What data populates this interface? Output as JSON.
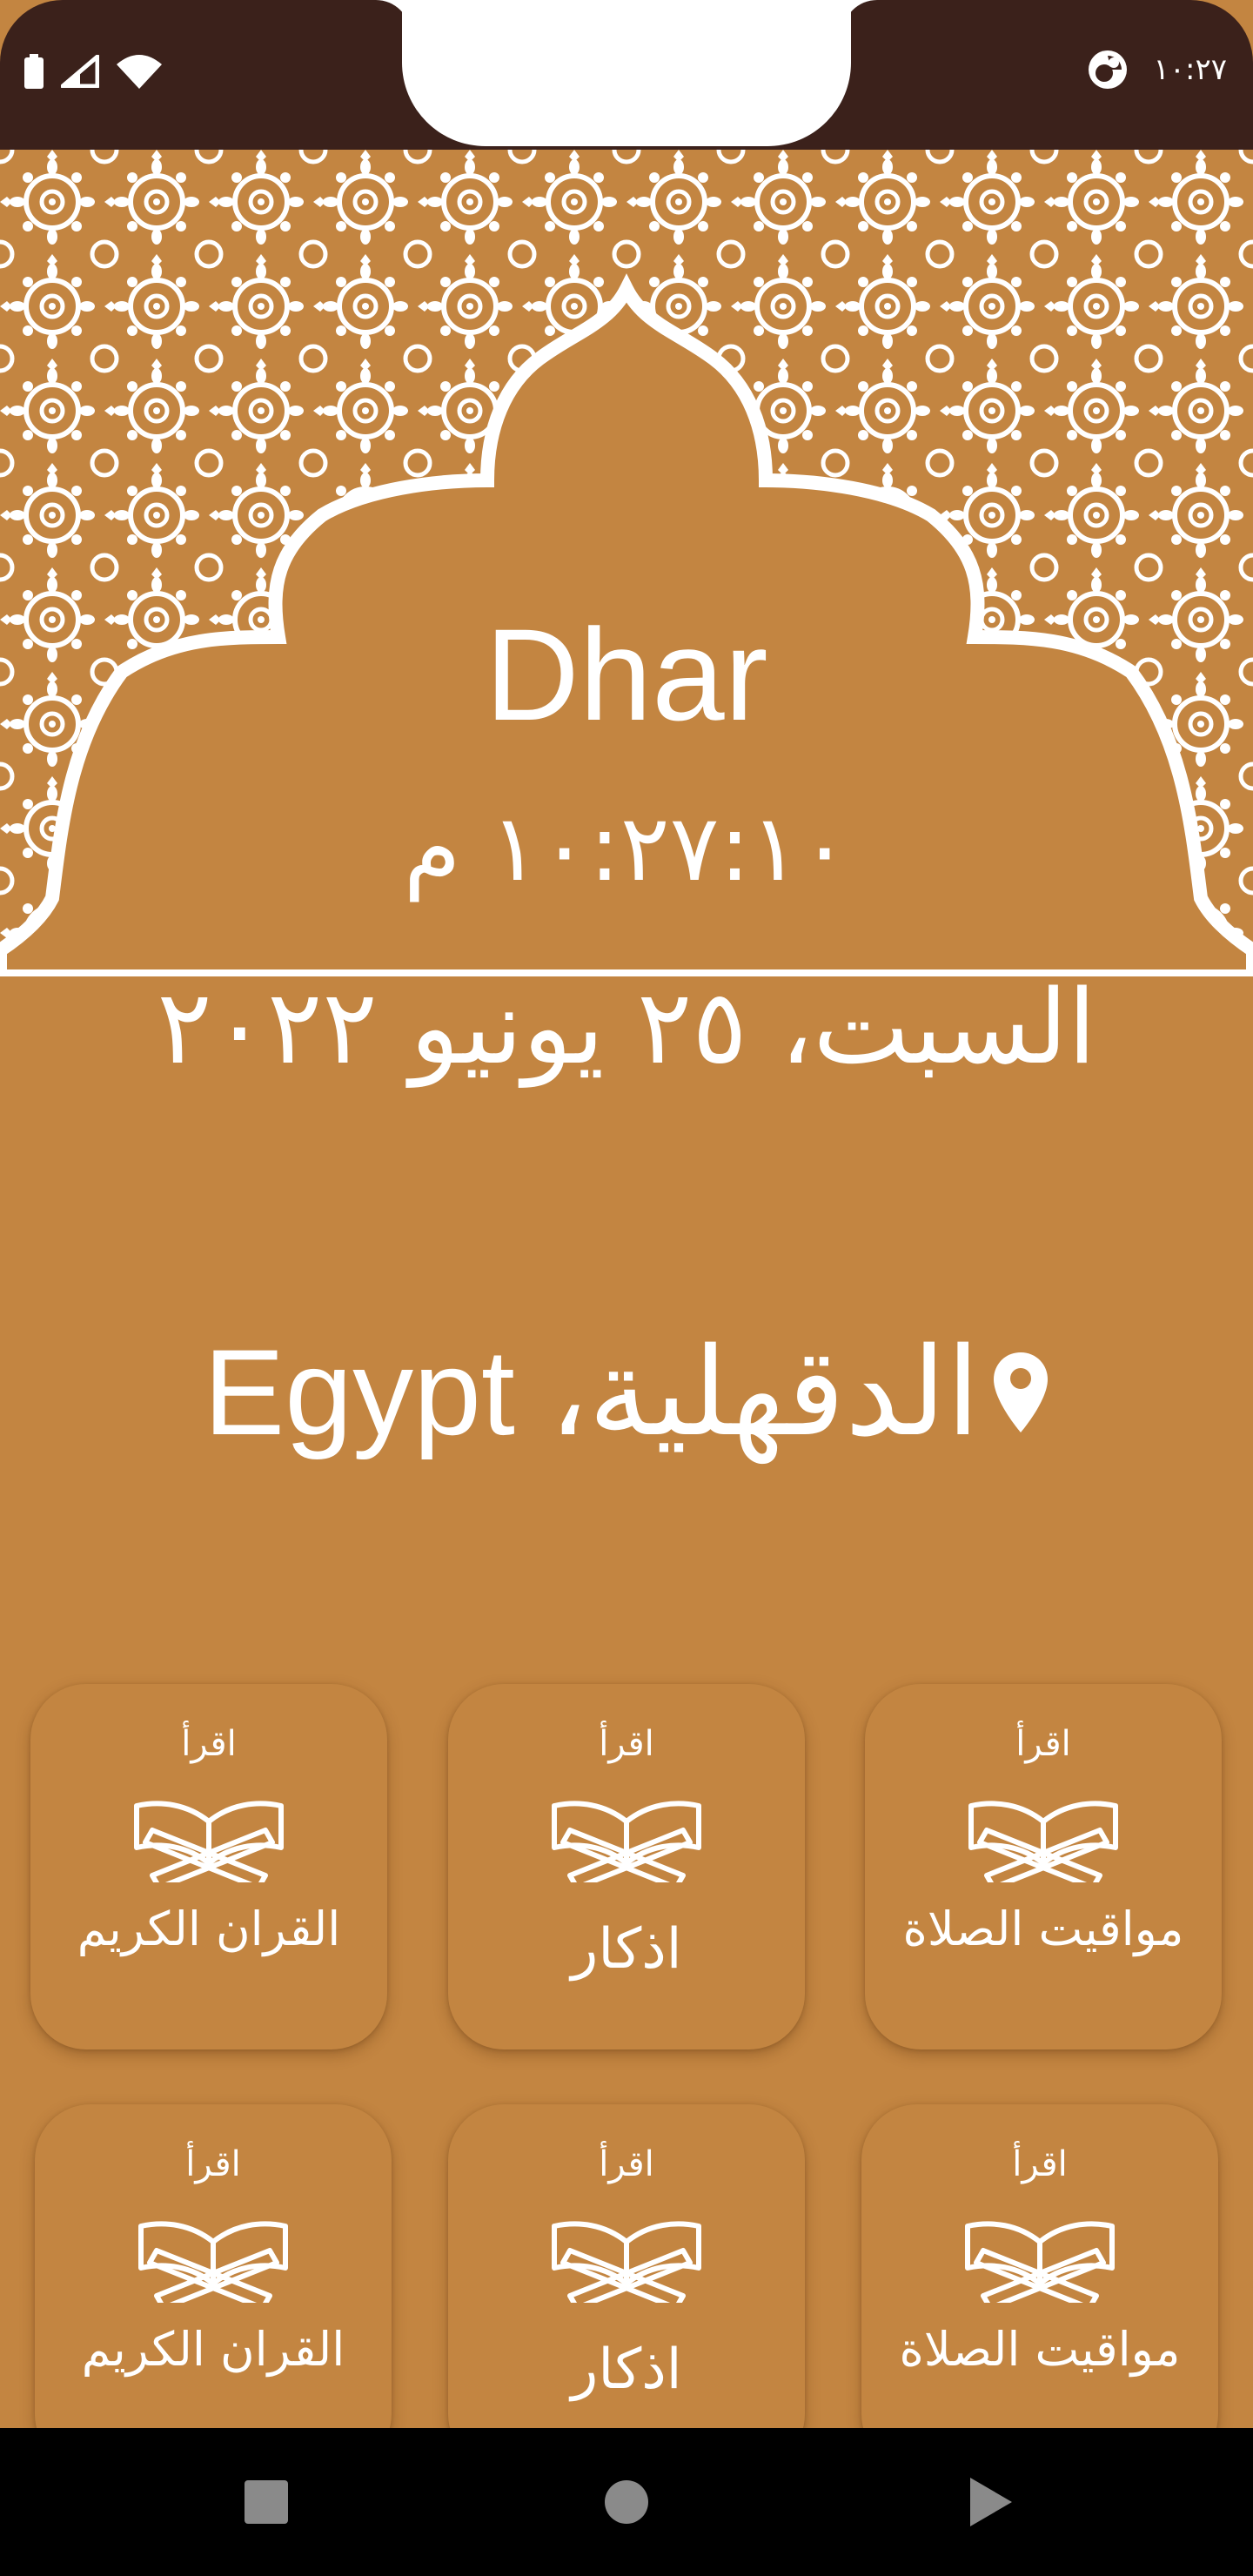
{
  "status_bar": {
    "time": "١٠:٢٧",
    "icons": [
      "battery-icon",
      "signal-icon",
      "wifi-icon",
      "data-saver-icon"
    ]
  },
  "prayer": {
    "name": "Dhar",
    "clock": "١٠:٢٧:١٠ م",
    "date": "السبت، ٢٥ يونيو ٢٠٢٢"
  },
  "location": {
    "text": "الدقهلية، Egypt",
    "icon": "location-pin-icon"
  },
  "book_icon_text": "اقرأ",
  "cards": [
    {
      "label": "مواقيت الصلاة",
      "icon": "quran-book-icon"
    },
    {
      "label": "اذكار",
      "icon": "quran-book-icon"
    },
    {
      "label": "القران الكريم",
      "icon": "quran-book-icon"
    },
    {
      "label": "مواقيت الصلاة",
      "icon": "quran-book-icon"
    },
    {
      "label": "اذكار",
      "icon": "quran-book-icon"
    },
    {
      "label": "القران الكريم",
      "icon": "quran-book-icon"
    }
  ],
  "colors": {
    "primary": "#C38541",
    "status_bar": "#3B211B",
    "pattern": "#FFFFFF",
    "text": "#FFFFFF",
    "nav_bar": "#000000",
    "nav_icons": "#8A8A8A"
  },
  "nav": {
    "items": [
      "recents-square-icon",
      "home-circle-icon",
      "back-triangle-icon"
    ]
  }
}
